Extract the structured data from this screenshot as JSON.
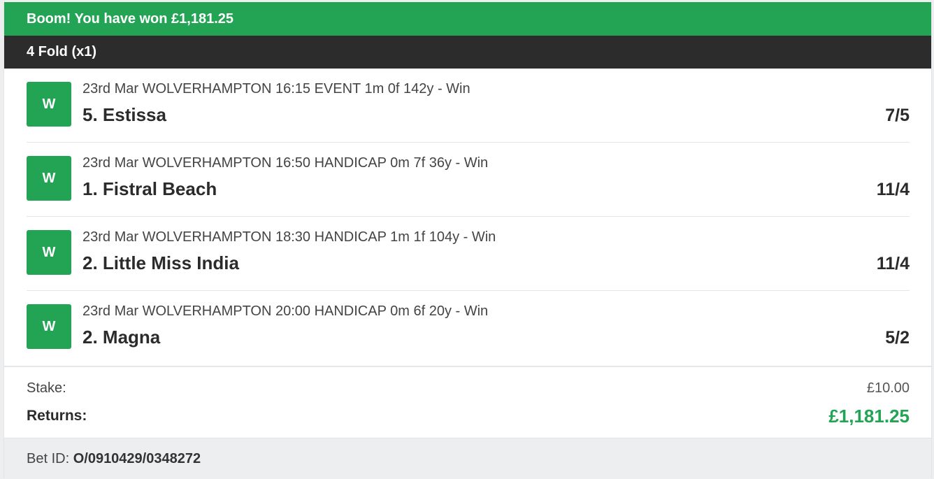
{
  "banner": {
    "message": "Boom! You have won £1,181.25",
    "color": "#23a455"
  },
  "bet_type": {
    "label": "4 Fold (x1)"
  },
  "selections": [
    {
      "status": "W",
      "event": "23rd Mar WOLVERHAMPTON 16:15 EVENT 1m 0f 142y - Win",
      "runner": "5. Estissa",
      "odds": "7/5"
    },
    {
      "status": "W",
      "event": "23rd Mar WOLVERHAMPTON 16:50 HANDICAP 0m 7f 36y - Win",
      "runner": "1. Fistral Beach",
      "odds": "11/4"
    },
    {
      "status": "W",
      "event": "23rd Mar WOLVERHAMPTON 18:30 HANDICAP 1m 1f 104y - Win",
      "runner": "2. Little Miss India",
      "odds": "11/4"
    },
    {
      "status": "W",
      "event": "23rd Mar WOLVERHAMPTON 20:00 HANDICAP 0m 6f 20y - Win",
      "runner": "2. Magna",
      "odds": "5/2"
    }
  ],
  "summary": {
    "stake_label": "Stake:",
    "stake_value": "£10.00",
    "returns_label": "Returns:",
    "returns_value": "£1,181.25"
  },
  "bet_id": {
    "label": "Bet ID:",
    "value": "O/0910429/0348272"
  }
}
